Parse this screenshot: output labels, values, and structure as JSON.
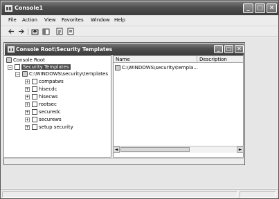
{
  "window": {
    "title": "Console1"
  },
  "title_buttons": {
    "minimize": "_",
    "maximize": "□",
    "close": "✕"
  },
  "menu": [
    "File",
    "Action",
    "View",
    "Favorites",
    "Window",
    "Help"
  ],
  "toolbar": {
    "back_icon": "arrow-left-icon",
    "forward_icon": "arrow-right-icon",
    "up_icon": "folder-up-icon",
    "show_hide_tree_icon": "console-tree-icon",
    "export_icon": "export-list-icon",
    "help_icon": "help-icon"
  },
  "child_window": {
    "title": "Console Root\\Security Templates"
  },
  "tree": {
    "root": "Console Root",
    "security_templates": "Security Templates",
    "folder": "C:\\WINDOWS\\security\\templates",
    "items": [
      "compatws",
      "hisecdc",
      "hisecws",
      "rootsec",
      "securedc",
      "securews",
      "setup security"
    ]
  },
  "list": {
    "columns": [
      "Name",
      "Description"
    ],
    "rows": [
      {
        "name": "C:\\WINDOWS\\security\\templa...",
        "description": ""
      }
    ]
  },
  "colors": {
    "titlebar": "#4e4e4e",
    "selection": "#4a4a4a"
  }
}
